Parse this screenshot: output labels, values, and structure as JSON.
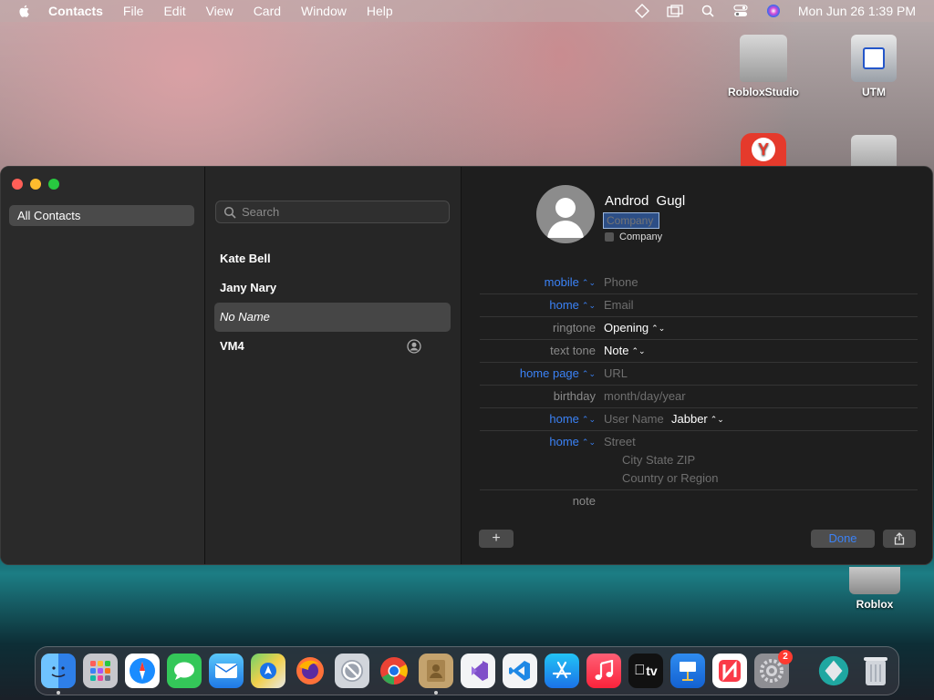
{
  "menubar": {
    "app_name": "Contacts",
    "items": [
      "File",
      "Edit",
      "View",
      "Card",
      "Window",
      "Help"
    ],
    "clock": "Mon Jun 26  1:39 PM"
  },
  "desktop_icons": [
    {
      "label": "RobloxStudio"
    },
    {
      "label": "UTM"
    },
    {
      "label": "Roblox"
    }
  ],
  "sidebar": {
    "group_label": "All Contacts"
  },
  "list": {
    "search_placeholder": "Search",
    "contacts": [
      {
        "name": "Kate Bell"
      },
      {
        "name": "Jany Nary"
      },
      {
        "name": "No Name"
      },
      {
        "name": "VM4"
      }
    ]
  },
  "card": {
    "first_name": "Androd",
    "last_name": "Gugl",
    "company_placeholder": "Company",
    "company_checkbox_label": "Company",
    "fields": [
      {
        "label": "mobile",
        "value": "Phone"
      },
      {
        "label": "home",
        "value": "Email"
      },
      {
        "label": "ringtone",
        "value": "Opening"
      },
      {
        "label": "text tone",
        "value": "Note"
      },
      {
        "label": "home page",
        "value": "URL"
      },
      {
        "label": "birthday",
        "value": "month/day/year"
      },
      {
        "label": "home",
        "value": "User Name",
        "extra": "Jabber"
      },
      {
        "label": "home",
        "value": "Street",
        "line2": "City State ZIP",
        "line3": "Country or Region"
      },
      {
        "label": "note",
        "value": ""
      }
    ],
    "add_label": "+",
    "done_label": "Done"
  },
  "dock": {
    "badge_count": "2",
    "apps": [
      "finder-icon",
      "launchpad-icon",
      "safari-icon",
      "messages-icon",
      "mail-icon",
      "maps-icon",
      "firefox-icon",
      "nosleep-icon",
      "chrome-icon",
      "contacts-icon",
      "visual-studio-icon",
      "vscode-icon",
      "app-store-icon",
      "music-icon",
      "tv-icon",
      "keynote-icon",
      "news-icon",
      "system-settings-icon",
      "xcode-cloud-icon",
      "trash-icon"
    ],
    "tv_label": "tv"
  },
  "colors": {
    "accent": "#3b82f6",
    "window_bg": "#1e1e1e",
    "selection": "#464646"
  }
}
